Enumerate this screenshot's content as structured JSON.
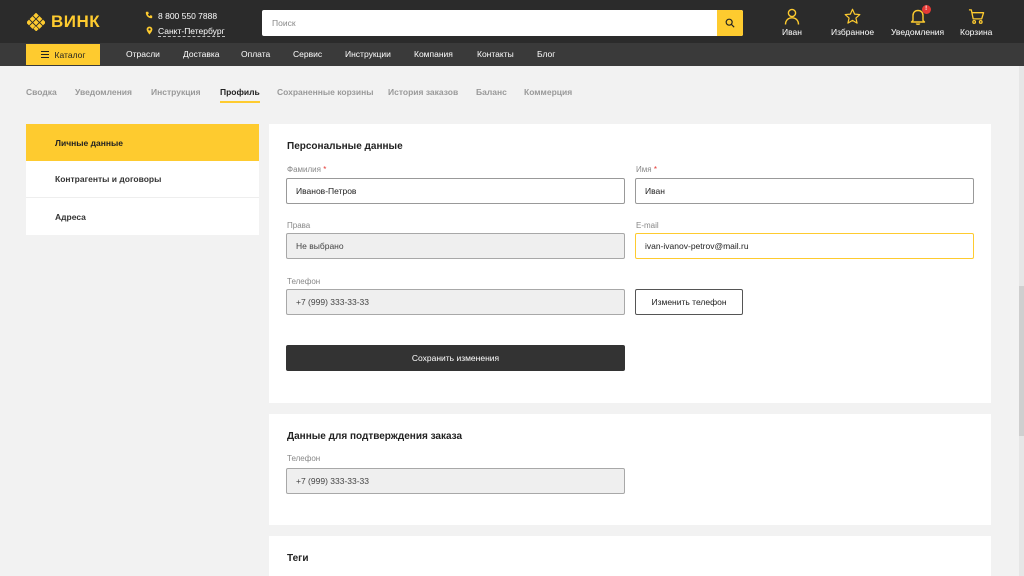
{
  "header": {
    "logo_text": "ВИНК",
    "phone": "8 800 550 7888",
    "city": "Санкт-Петербург",
    "search_placeholder": "Поиск",
    "actions": [
      {
        "label": "Иван",
        "icon": "user-icon"
      },
      {
        "label": "Избранное",
        "icon": "star-icon"
      },
      {
        "label": "Уведомления",
        "icon": "bell-icon",
        "badge": "!"
      },
      {
        "label": "Корзина",
        "icon": "cart-icon"
      }
    ]
  },
  "nav": {
    "catalog": "Каталог",
    "items": [
      "Отрасли",
      "Доставка",
      "Оплата",
      "Сервис",
      "Инструкции",
      "Компания",
      "Контакты",
      "Блог"
    ]
  },
  "tabs": [
    "Сводка",
    "Уведомления",
    "Инструкция",
    "Профиль",
    "Сохраненные корзины",
    "История заказов",
    "Баланс",
    "Коммерция"
  ],
  "active_tab": "Профиль",
  "sidebar": {
    "items": [
      "Личные данные",
      "Контрагенты и договоры",
      "Адреса"
    ],
    "active": "Личные данные"
  },
  "personal": {
    "title": "Персональные данные",
    "surname_label": "Фамилия",
    "surname_value": "Иванов-Петров",
    "name_label": "Имя",
    "name_value": "Иван",
    "rights_label": "Права",
    "rights_value": "Не выбрано",
    "email_label": "E-mail",
    "email_value": "ivan-ivanov-petrov@mail.ru",
    "phone_label": "Телефон",
    "phone_value": "+7 (999) 333-33-33",
    "change_phone": "Изменить телефон",
    "save": "Сохранить изменения",
    "required_mark": "*"
  },
  "confirm": {
    "title": "Данные для подтверждения заказа",
    "phone_label": "Телефон",
    "phone_value": "+7 (999) 333-33-33"
  },
  "tags": {
    "title": "Теги"
  },
  "colors": {
    "accent": "#fecb2f",
    "header_bg": "#2b2b2b",
    "nav_bg": "#3a3a3a",
    "page_bg": "#f2f2f2"
  }
}
